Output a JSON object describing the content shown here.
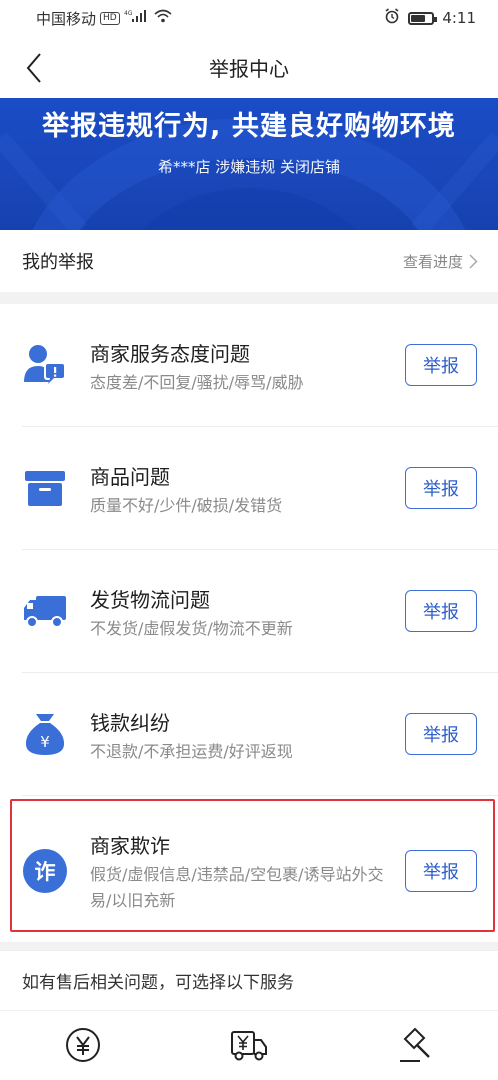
{
  "status_bar": {
    "carrier": "中国移动",
    "hd": "HD",
    "network": "4G",
    "time": "4:11",
    "battery_level": 0.62
  },
  "nav": {
    "title": "举报中心"
  },
  "banner": {
    "title": "举报违规行为, 共建良好购物环境",
    "subtitle": "希***店 涉嫌违规 关闭店铺"
  },
  "my_report": {
    "title": "我的举报",
    "link": "查看进度"
  },
  "report_items": [
    {
      "title": "商家服务态度问题",
      "desc": "态度差/不回复/骚扰/辱骂/威胁",
      "button": "举报",
      "icon": "merchant-attitude-icon"
    },
    {
      "title": "商品问题",
      "desc": "质量不好/少件/破损/发错货",
      "button": "举报",
      "icon": "product-box-icon"
    },
    {
      "title": "发货物流问题",
      "desc": "不发货/虚假发货/物流不更新",
      "button": "举报",
      "icon": "delivery-truck-icon"
    },
    {
      "title": "钱款纠纷",
      "desc": "不退款/不承担运费/好评返现",
      "button": "举报",
      "icon": "money-bag-icon"
    },
    {
      "title": "商家欺诈",
      "desc": "假货/虚假信息/违禁品/空包裹/诱导站外交易/以旧充新",
      "button": "举报",
      "icon": "fraud-icon",
      "icon_text": "诈"
    }
  ],
  "after_sales": {
    "text": "如有售后相关问题，可选择以下服务"
  },
  "services": [
    {
      "icon": "yen-circle-icon"
    },
    {
      "icon": "yen-truck-icon"
    },
    {
      "icon": "gavel-icon"
    }
  ],
  "colors": {
    "accent": "#2e5fc9",
    "icon_blue": "#3a6fd8",
    "banner": "#1a47b9",
    "highlight": "#e0333c"
  }
}
